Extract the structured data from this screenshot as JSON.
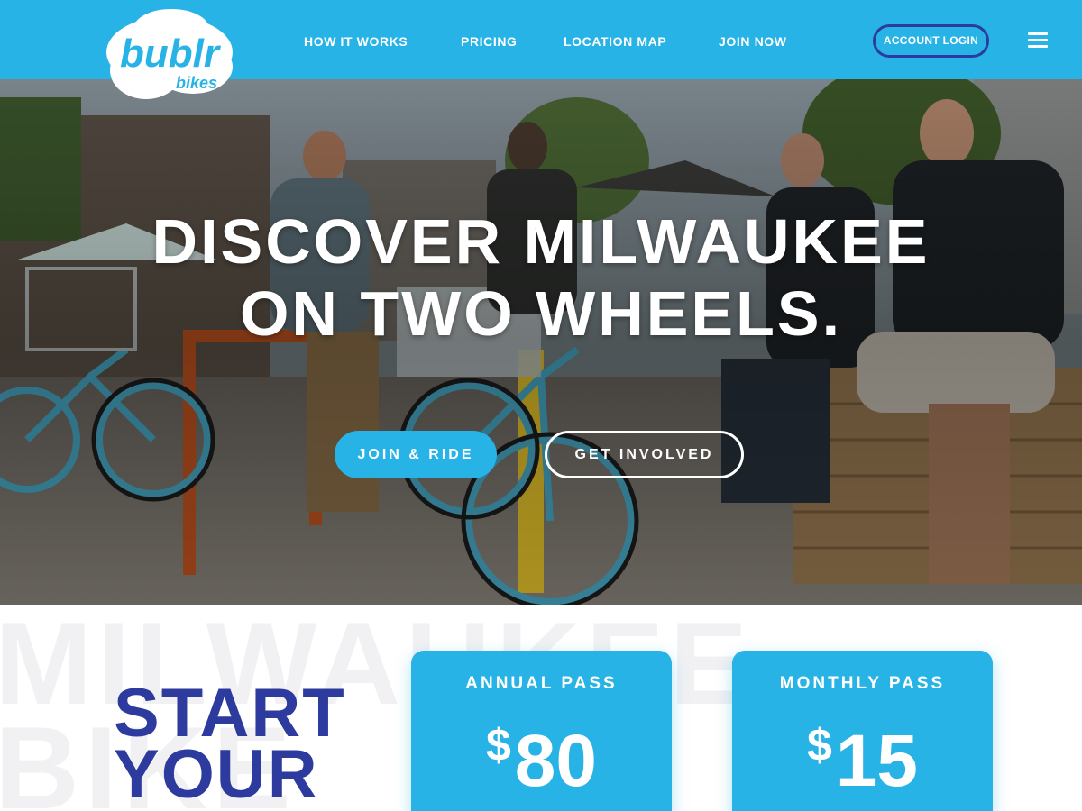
{
  "brand": {
    "logo_main": "bublr",
    "logo_sub": "bikes",
    "primary_color": "#27b3e6",
    "accent_color": "#2d3a9e"
  },
  "nav": {
    "items": [
      {
        "label": "HOW IT WORKS"
      },
      {
        "label": "PRICING"
      },
      {
        "label": "LOCATION MAP"
      },
      {
        "label": "JOIN NOW"
      }
    ],
    "account_login": "ACCOUNT LOGIN",
    "menu_icon": "hamburger-menu-icon"
  },
  "hero": {
    "title_line1": "DISCOVER MILWAUKEE",
    "title_line2": "ON TWO WHEELS.",
    "join_button": "JOIN & RIDE",
    "involved_button": "GET INVOLVED"
  },
  "section": {
    "watermark_line1": "MILWAUKEE",
    "watermark_line2": "BIKE",
    "heading_line1": "START",
    "heading_line2": "YOUR"
  },
  "passes": [
    {
      "title": "ANNUAL PASS",
      "currency": "$",
      "price": "80"
    },
    {
      "title": "MONTHLY PASS",
      "currency": "$",
      "price": "15"
    }
  ]
}
